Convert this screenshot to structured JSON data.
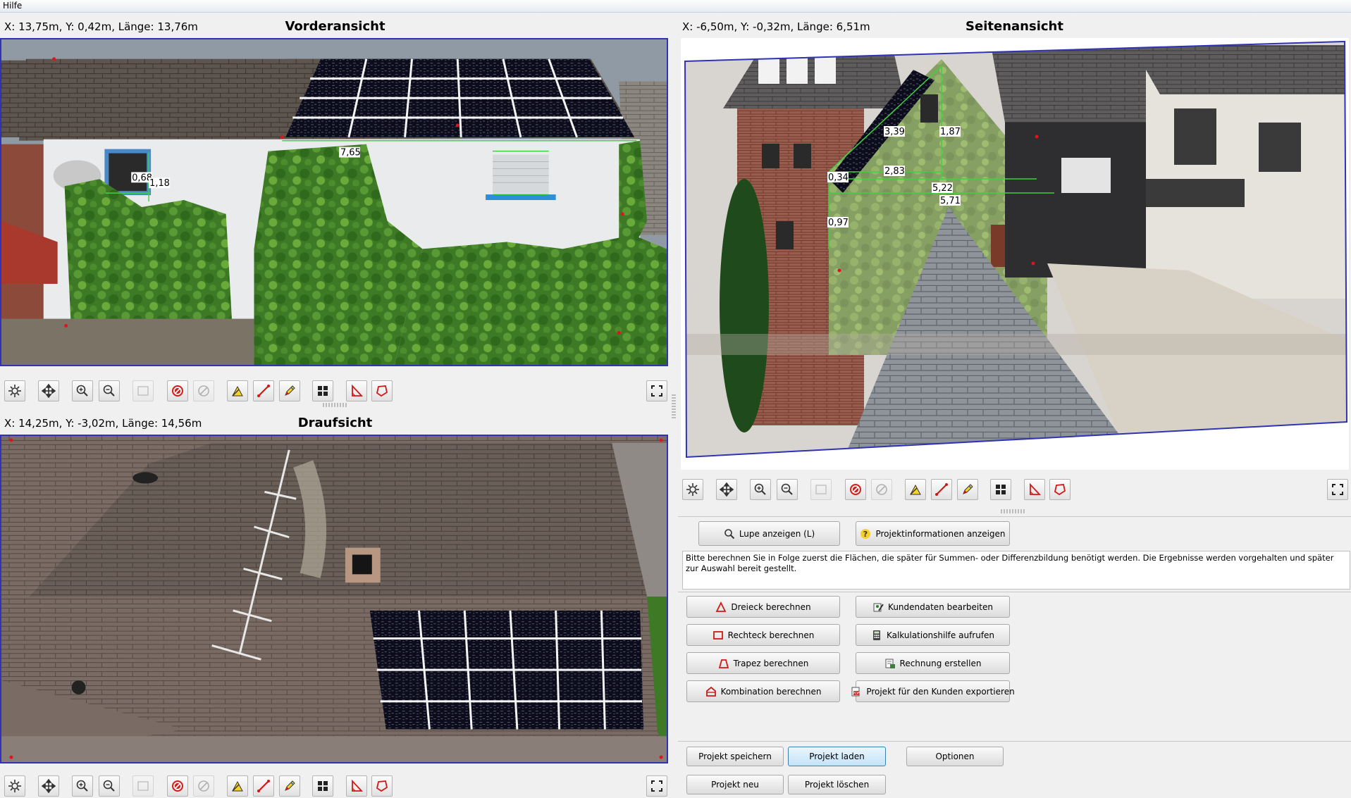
{
  "menu": {
    "help": "Hilfe"
  },
  "front": {
    "title": "Vorderansicht",
    "coords": "X: 13,75m, Y: 0,42m, Länge: 13,76m",
    "labels": [
      "7,65",
      "0,68",
      "1,18"
    ]
  },
  "side": {
    "title": "Seitenansicht",
    "coords": "X: -6,50m, Y: -0,32m, Länge: 6,51m",
    "labels": [
      "3,39",
      "1,87",
      "0,34",
      "2,83",
      "5,22",
      "5,71",
      "0,97"
    ]
  },
  "top": {
    "title": "Draufsicht",
    "coords": "X: 14,25m, Y: -3,02m, Länge: 14,56m"
  },
  "toolbar_icons": [
    "settings-icon",
    "move-icon",
    "zoom-in-icon",
    "zoom-out-icon",
    "rectangle-select-icon",
    "delete-icon",
    "clear-icon",
    "measure-angle-icon",
    "measure-line-icon",
    "pen-icon",
    "panel-grid-icon",
    "triangle-tool-icon",
    "polygon-tool-icon",
    "fullscreen-icon"
  ],
  "panel": {
    "magnifier": "Lupe anzeigen (L)",
    "project_info": "Projektinformationen anzeigen",
    "hint": "Bitte berechnen Sie in Folge zuerst die Flächen, die später für Summen- oder Differenzbildung benötigt werden. Die Ergebnisse werden vorgehalten und später zur Auswahl bereit gestellt.",
    "triangle": "Dreieck berechnen",
    "rectangle": "Rechteck berechnen",
    "trapezoid": "Trapez berechnen",
    "combination": "Kombination berechnen",
    "customer_data": "Kundendaten bearbeiten",
    "calc_help": "Kalkulationshilfe aufrufen",
    "invoice": "Rechnung erstellen",
    "export": "Projekt für den Kunden exportieren",
    "save": "Projekt speichern",
    "load": "Projekt laden",
    "options": "Optionen",
    "new": "Projekt neu",
    "delete": "Projekt löschen"
  },
  "colors": {
    "accent": "#2f33b4",
    "measure": "#3fd23f",
    "marker": "#e0141e"
  }
}
